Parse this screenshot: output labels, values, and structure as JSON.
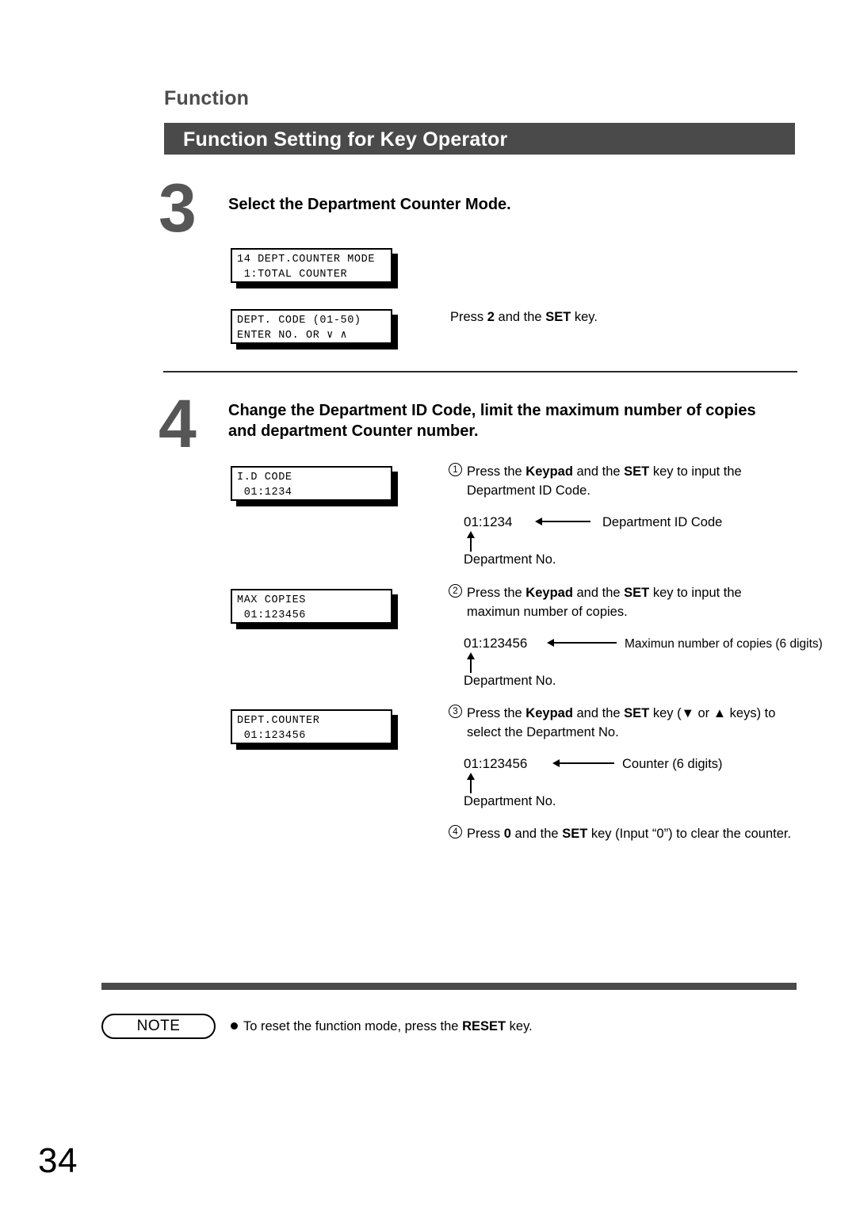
{
  "page": {
    "section_label": "Function",
    "title": "Function Setting for Key Operator",
    "page_number": "34",
    "accent_dark": "#4a4a4a",
    "step_number_color": "#565656"
  },
  "steps": [
    {
      "number": "3",
      "heading": "Select the Department Counter Mode.",
      "displays": [
        {
          "line1": "14 DEPT.COUNTER MODE",
          "line2": " 1:TOTAL COUNTER"
        },
        {
          "line1": "DEPT. CODE (01-50)",
          "line2": "ENTER NO. OR ∨ ∧"
        }
      ],
      "instruction": {
        "pre": "Press ",
        "key1": "2",
        "mid": " and the ",
        "key2": "SET",
        "post": " key."
      }
    },
    {
      "number": "4",
      "heading_line1": "Change the Department ID Code, limit the maximum number of copies",
      "heading_line2": "and department Counter number."
    }
  ],
  "substeps": [
    {
      "marker": "1",
      "display": {
        "line1": "I.D CODE",
        "line2": " 01:1234"
      },
      "text_line1_pre": "Press the ",
      "text_line1_key1": "Keypad",
      "text_line1_mid": " and the ",
      "text_line1_key2": "SET",
      "text_line1_post": " key to input the",
      "text_line2": "Department ID Code.",
      "annot_code": "01:1234",
      "annot_label": "Department ID Code",
      "annot_sub_label": "Department No."
    },
    {
      "marker": "2",
      "display": {
        "line1": "MAX COPIES",
        "line2": " 01:123456"
      },
      "text_line1_pre": "Press the ",
      "text_line1_key1": "Keypad",
      "text_line1_mid": " and the ",
      "text_line1_key2": "SET",
      "text_line1_post": " key to input the",
      "text_line2": "maximun number of copies.",
      "annot_code": "01:123456",
      "annot_label": "Maximun number of copies (6 digits)",
      "annot_sub_label": "Department No."
    },
    {
      "marker": "3",
      "display": {
        "line1": "DEPT.COUNTER",
        "line2": " 01:123456"
      },
      "text_line1_pre": "Press the ",
      "text_line1_key1": "Keypad",
      "text_line1_mid": " and the ",
      "text_line1_key2": "SET",
      "text_line1_post": " key (▼ or ▲ keys) to",
      "text_line2": "select the Department No.",
      "annot_code": "01:123456",
      "annot_label": "Counter (6 digits)",
      "annot_sub_label": "Department No."
    }
  ],
  "substep4": {
    "marker": "4",
    "pre": "Press ",
    "key1": "0",
    "mid": " and the ",
    "key2": "SET",
    "post": " key (Input “0”) to clear the counter."
  },
  "note": {
    "label": "NOTE",
    "text_pre": "To reset the function mode, press the ",
    "key": "RESET",
    "text_post": " key."
  }
}
